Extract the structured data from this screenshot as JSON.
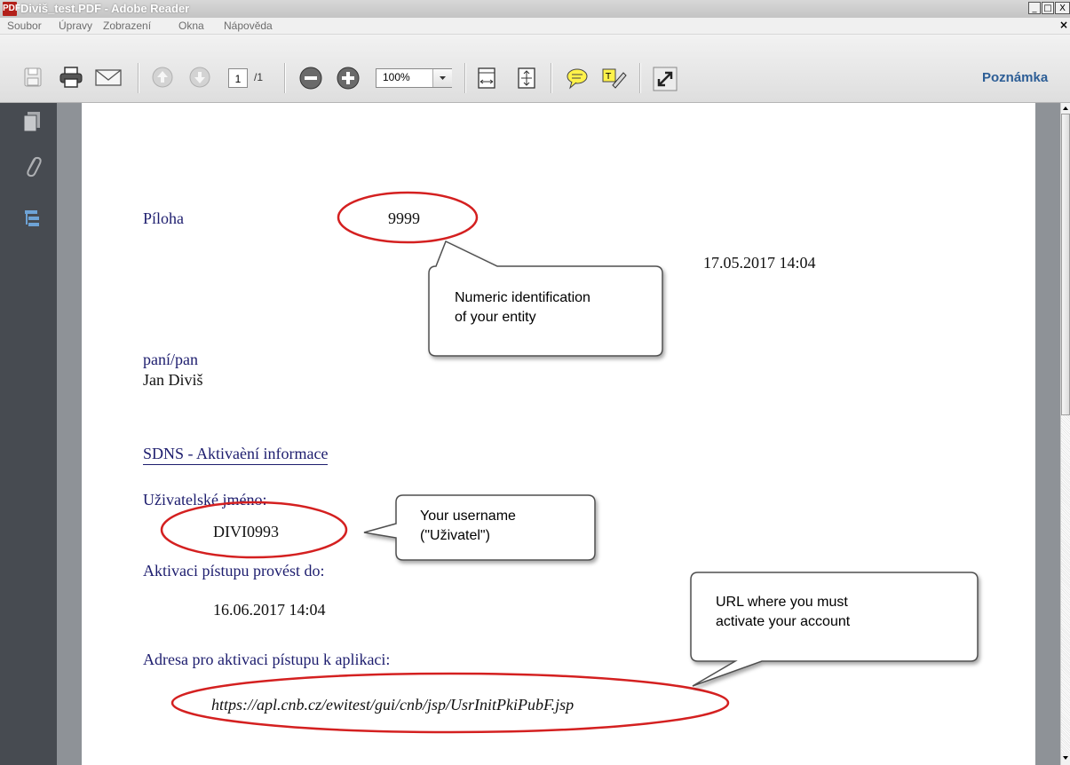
{
  "window": {
    "title": "Diviš_test.PDF - Adobe Reader",
    "app_icon": "pdf-icon",
    "buttons": {
      "minimize": "_",
      "maximize": "□",
      "close": "X"
    }
  },
  "menu": {
    "items": [
      "Soubor",
      "Úpravy",
      "Zobrazení",
      "Okna",
      "Nápověda"
    ],
    "close_doc": "×"
  },
  "toolbar": {
    "icons": [
      "save-icon",
      "print-icon",
      "email-icon",
      "page-up-icon",
      "page-down-icon",
      "zoom-out-icon",
      "zoom-in-icon",
      "fit-width-icon",
      "fit-page-icon",
      "comment-icon",
      "highlight-icon",
      "fullscreen-icon"
    ],
    "page_current": "1",
    "page_total": "/1",
    "zoom": "100%",
    "comment_label": "Poznámka"
  },
  "nav_pane": {
    "icons": [
      "pages-icon",
      "attachment-icon",
      "layers-icon"
    ]
  },
  "document": {
    "attachment_label": "Píloha",
    "attachment_value": "9999",
    "datetime": "17.05.2017 14:04",
    "salutation": "paní/pan",
    "name": "Jan Diviš",
    "heading": "SDNS - Aktivaèní informace",
    "username_label": "Uživatelské jméno:",
    "username": "DIVI0993",
    "deadline_label": "Aktivaci pístupu provést do:",
    "deadline": "16.06.2017 14:04",
    "address_label": "Adresa pro aktivaci pístupu k aplikaci:",
    "url": "https://apl.cnb.cz/ewitest/gui/cnb/jsp/UsrInitPkiPubF.jsp"
  },
  "callouts": {
    "entity_line1": "Numeric identification",
    "entity_line2": "of your entity",
    "username_line1": "Your username",
    "username_line2": "(\"Uživatel\")",
    "url_line1": "URL where you must",
    "url_line2": "activate your account"
  },
  "colors": {
    "doc_text": "#1d1d6e",
    "ellipse": "#d42020",
    "link_blue": "#2d5e96",
    "nav_pane": "#474b51"
  }
}
